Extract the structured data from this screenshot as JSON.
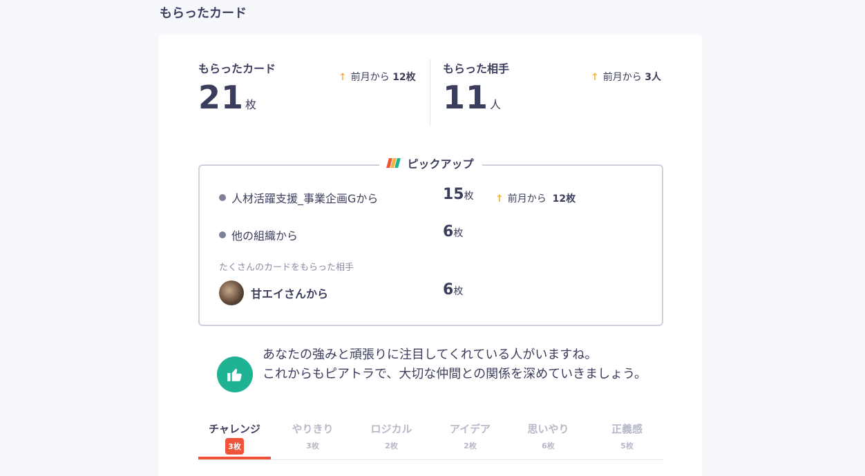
{
  "section_title": "もらったカード",
  "stats": {
    "cards": {
      "label": "もらったカード",
      "value": "21",
      "unit": "枚",
      "change_prefix": "前月から",
      "change_value": "12枚"
    },
    "people": {
      "label": "もらった相手",
      "value": "11",
      "unit": "人",
      "change_prefix": "前月から",
      "change_value": "3人"
    }
  },
  "pickup": {
    "title": "ピックアップ",
    "rows": [
      {
        "label": "人材活躍支援_事業企画Gから",
        "count": "15",
        "unit": "枚",
        "change_prefix": "前月から",
        "change_value": "12枚"
      },
      {
        "label": "他の組織から",
        "count": "6",
        "unit": "枚"
      }
    ],
    "subnote": "たくさんのカードをもらった相手",
    "top_person": {
      "name": "甘エイさんから",
      "count": "6",
      "unit": "枚"
    }
  },
  "message": {
    "line1": "あなたの強みと頑張りに注目してくれている人がいますね。",
    "line2": "これからもピアトラで、大切な仲間との関係を深めていきましょう。"
  },
  "tabs": [
    {
      "label": "チャレンジ",
      "count": "3枚"
    },
    {
      "label": "やりきり",
      "count": "3枚"
    },
    {
      "label": "ロジカル",
      "count": "2枚"
    },
    {
      "label": "アイデア",
      "count": "2枚"
    },
    {
      "label": "思いやり",
      "count": "6枚"
    },
    {
      "label": "正義感",
      "count": "5枚"
    }
  ],
  "colors": {
    "accent": "#f0533a",
    "arrow": "#f5b33d",
    "thumb": "#1fb394",
    "text": "#3b3d5c"
  }
}
